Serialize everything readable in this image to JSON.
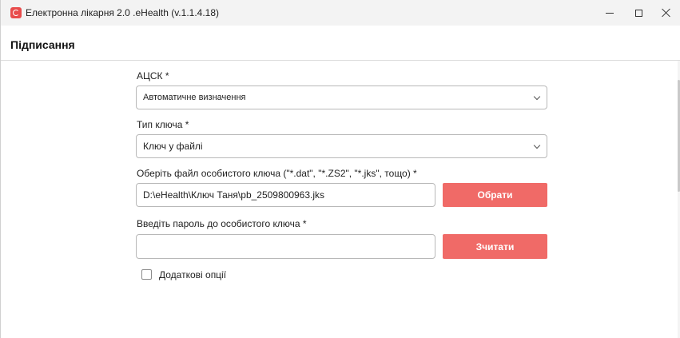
{
  "window": {
    "title": "Електронна лікарня 2.0 .eHealth (v.1.1.4.18)"
  },
  "page": {
    "title": "Підписання"
  },
  "form": {
    "acsk": {
      "label": "АЦСК *",
      "value": "Автоматичне визначення"
    },
    "key_type": {
      "label": "Тип ключа *",
      "value": "Ключ у файлі"
    },
    "key_file": {
      "label": "Оберіть файл особистого ключа (\"*.dat\", \"*.ZS2\", \"*.jks\", тощо) *",
      "value": "D:\\eHealth\\Ключ Таня\\pb_2509800963.jks",
      "button_label": "Обрати"
    },
    "password": {
      "label": "Введіть пароль до особистого ключа *",
      "value": "",
      "button_label": "Зчитати"
    },
    "extra_options": {
      "label": "Додаткові опції",
      "checked": false
    }
  },
  "colors": {
    "accent": "#f06a67",
    "title_bar": "#f3f3f3"
  },
  "icons": {
    "app": "ehealth-app-icon",
    "window_controls": [
      "minimize-icon",
      "maximize-icon",
      "close-icon"
    ],
    "dropdown": "chevron-down-icon"
  }
}
